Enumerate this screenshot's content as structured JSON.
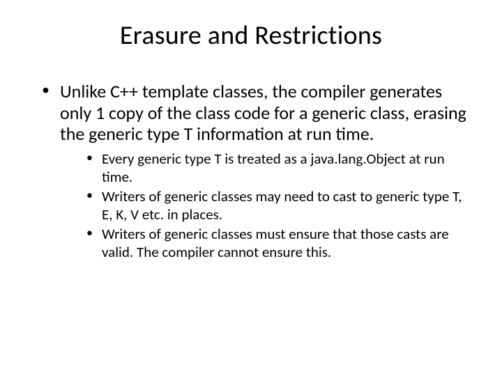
{
  "title": "Erasure and Restrictions",
  "bullets": [
    {
      "text": "Unlike C++ template classes, the compiler generates only 1 copy of the class code for a generic class, erasing the generic type T information at run time.",
      "sub": [
        {
          "text": "Every generic type T is treated as a java.lang.Object at run time."
        },
        {
          "text": "Writers of generic classes may need to cast to generic type T, E, K, V etc. in places."
        },
        {
          "text": "Writers of generic classes must ensure that those casts are valid. The compiler cannot ensure this."
        }
      ]
    }
  ]
}
